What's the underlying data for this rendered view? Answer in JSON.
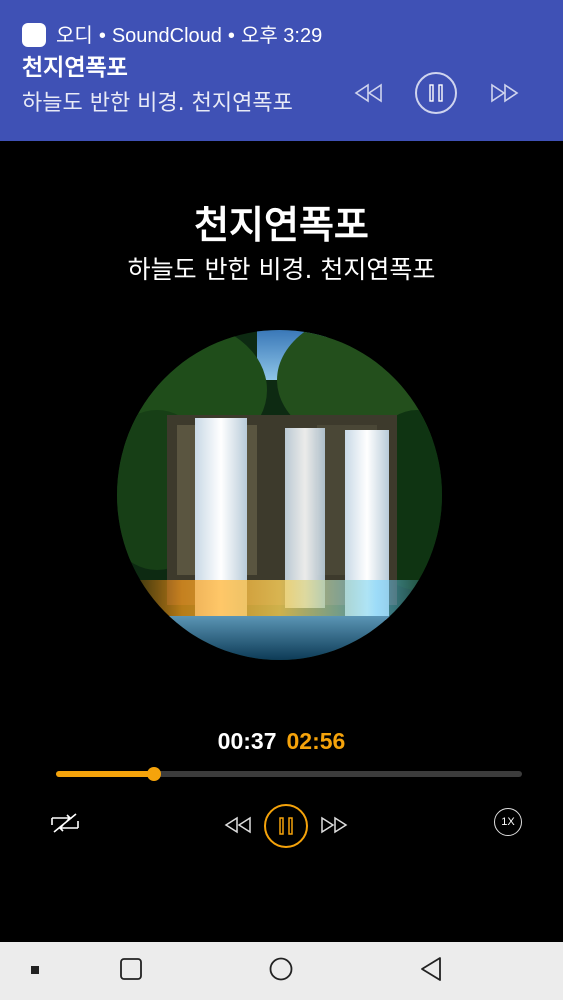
{
  "notification": {
    "app_name": "오디",
    "source": "SoundCloud",
    "time": "오후 3:29",
    "separator": "•",
    "title": "천지연폭포",
    "subtitle": "하늘도 반한 비경. 천지연폭포"
  },
  "player": {
    "title": "천지연폭포",
    "subtitle": "하늘도 반한 비경. 천지연폭포",
    "current_time": "00:37",
    "total_time": "02:56",
    "progress_fraction": 0.21,
    "speed_label": "1X",
    "artwork_icon": "waterfall-artwork"
  },
  "colors": {
    "notification_bg": "#3f51b5",
    "accent": "#f5a30b",
    "background": "#000000",
    "navbar_bg": "#ececec"
  },
  "icons": {
    "notification": [
      "app-icon",
      "rewind-icon",
      "pause-icon",
      "fast-forward-icon"
    ],
    "player": [
      "shuffle-off-icon",
      "rewind-icon",
      "pause-icon",
      "fast-forward-icon",
      "speed-icon"
    ],
    "navbar": [
      "dot-icon",
      "recents-icon",
      "home-icon",
      "back-icon"
    ]
  }
}
